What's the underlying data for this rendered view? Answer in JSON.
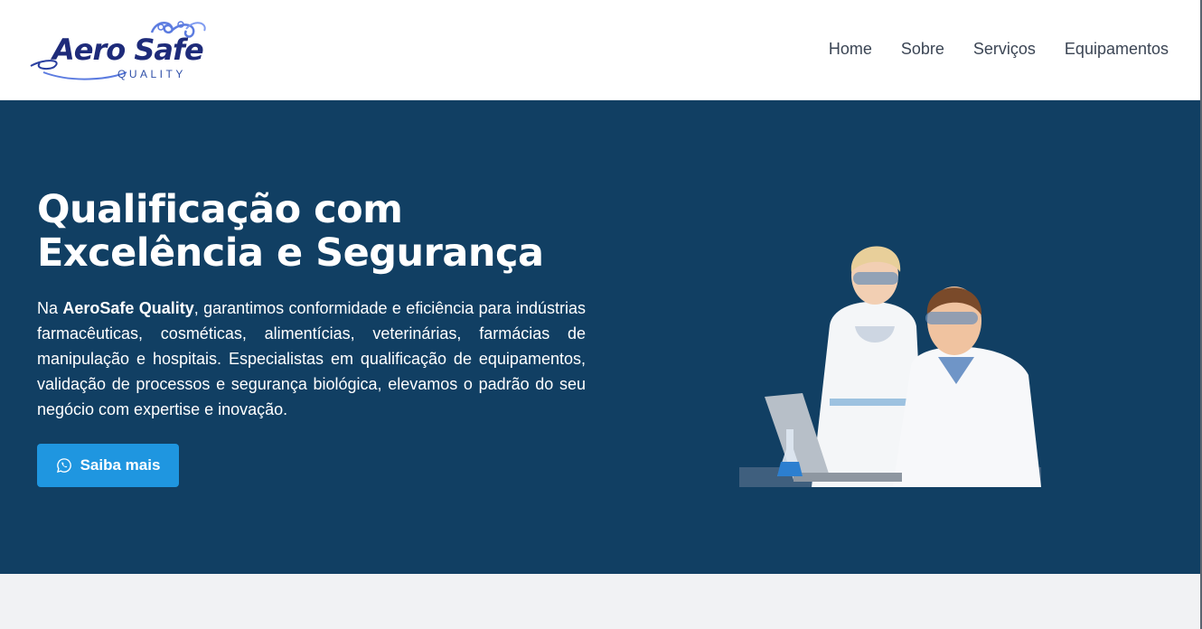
{
  "brand": {
    "name": "Aero Safe",
    "tagline": "QUALITY",
    "colors": {
      "primary": "#1e2b7a",
      "accent": "#5b7be0"
    }
  },
  "nav": {
    "items": [
      {
        "label": "Home"
      },
      {
        "label": "Sobre"
      },
      {
        "label": "Serviços"
      },
      {
        "label": "Equipamentos"
      }
    ]
  },
  "hero": {
    "title_line1": "Qualificação com",
    "title_line2": "Excelência e Segurança",
    "text_prefix": "Na ",
    "text_brand": "AeroSafe Quality",
    "text_body": ", garantimos conformidade e eficiência para indústrias farmacêuticas, cosméticas, alimentícias, veterinárias, farmácias de manipulação e hospitais. Especialistas em qualificação de equipamentos, validação de processos e segurança biológica, elevamos o padrão do seu negócio com expertise e inovação.",
    "cta_label": "Saiba mais",
    "cta_icon": "whatsapp-icon",
    "image": "scientists-at-laptop",
    "colors": {
      "background": "#113f63",
      "button": "#1f96e0"
    }
  }
}
